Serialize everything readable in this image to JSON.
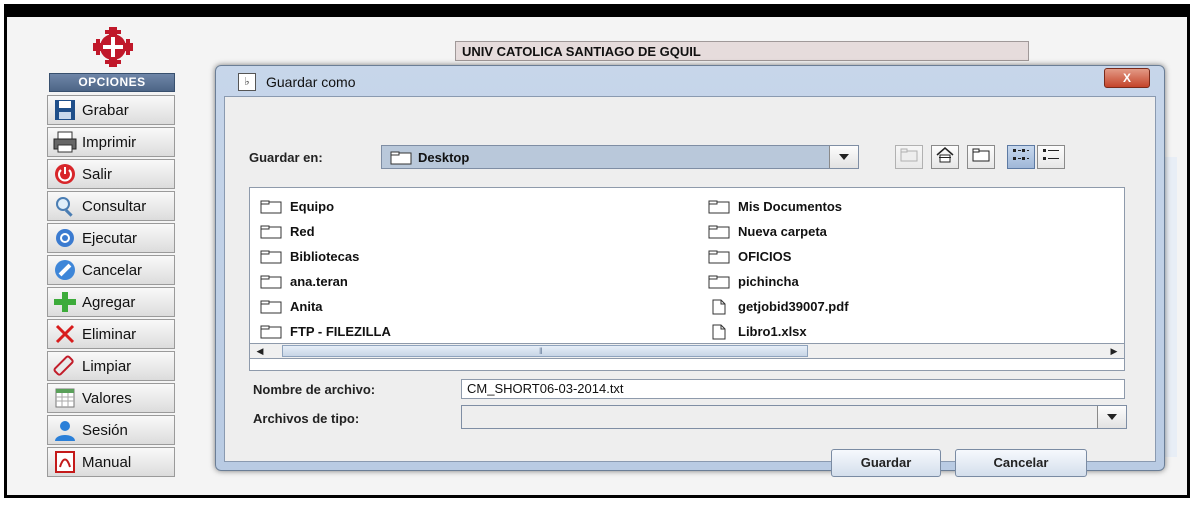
{
  "app": {
    "options_header": "OPCIONES",
    "institution_name": "UNIV CATOLICA SANTIAGO DE GQUIL",
    "sidebar": [
      {
        "label": "Grabar",
        "icon": "floppy-disk-icon"
      },
      {
        "label": "Imprimir",
        "icon": "printer-icon"
      },
      {
        "label": "Salir",
        "icon": "power-icon"
      },
      {
        "label": "Consultar",
        "icon": "magnifier-icon"
      },
      {
        "label": "Ejecutar",
        "icon": "run-icon"
      },
      {
        "label": "Cancelar",
        "icon": "cancel-icon"
      },
      {
        "label": "Agregar",
        "icon": "plus-icon"
      },
      {
        "label": "Eliminar",
        "icon": "x-icon"
      },
      {
        "label": "Limpiar",
        "icon": "eraser-icon"
      },
      {
        "label": "Valores",
        "icon": "spreadsheet-icon"
      },
      {
        "label": "Sesión",
        "icon": "user-icon"
      },
      {
        "label": "Manual",
        "icon": "pdf-icon"
      }
    ]
  },
  "dialog": {
    "title": "Guardar como",
    "close_label": "X",
    "save_in_label": "Guardar en:",
    "save_in_value": "Desktop",
    "files_left": [
      "Equipo",
      "Red",
      "Bibliotecas",
      "ana.teran",
      "Anita",
      "FTP - FILEZILLA"
    ],
    "files_right": [
      {
        "name": "Mis Documentos",
        "type": "folder"
      },
      {
        "name": "Nueva carpeta",
        "type": "folder"
      },
      {
        "name": "OFICIOS",
        "type": "folder"
      },
      {
        "name": "pichincha",
        "type": "folder"
      },
      {
        "name": "getjobid39007.pdf",
        "type": "file"
      },
      {
        "name": "Libro1.xlsx",
        "type": "file"
      }
    ],
    "filename_label": "Nombre de archivo:",
    "filename_value": "CM_SHORT06-03-2014.txt",
    "filetype_label": "Archivos de tipo:",
    "filetype_value": "",
    "save_button": "Guardar",
    "cancel_button": "Cancelar"
  },
  "colors": {
    "dialog_frame": "#b9cbe3",
    "close_button": "#c4442a",
    "opciones_header": "#4d6586"
  }
}
